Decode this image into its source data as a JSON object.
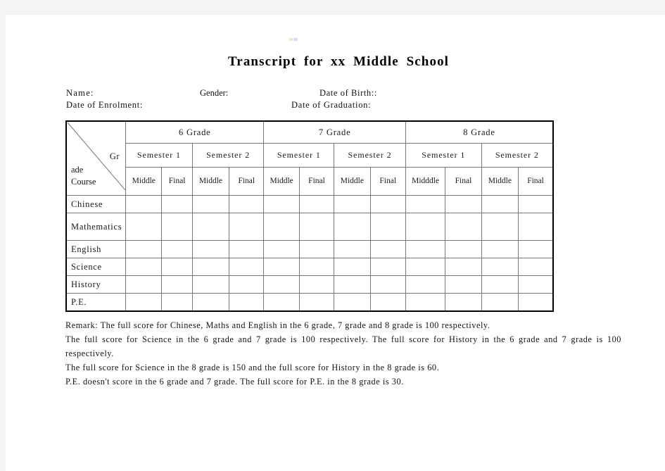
{
  "document": {
    "title": "Transcript for xx Middle School",
    "fields": {
      "name_label": "Name:",
      "gender_label": "Gender:",
      "date_of_birth_label": "Date of Birth::",
      "date_of_enrolment_label": "Date of Enrolment:",
      "date_of_graduation_label": "Date of Graduation:"
    }
  },
  "table": {
    "corner": {
      "grade_label": "Grade",
      "grade_part_upper": "Gr",
      "grade_part_lower": "ade",
      "course_label": "Course"
    },
    "grade_groups": [
      {
        "label": "6 Grade"
      },
      {
        "label": "7 Grade"
      },
      {
        "label": "8 Grade"
      }
    ],
    "semesters": [
      {
        "label": "Semester 1"
      },
      {
        "label": "Semester 2"
      },
      {
        "label": "Semester 1"
      },
      {
        "label": "Semester 2"
      },
      {
        "label": "Semester 1"
      },
      {
        "label": "Semester 2"
      }
    ],
    "exam_columns": [
      {
        "label": "Middle"
      },
      {
        "label": "Final"
      },
      {
        "label": "Middle"
      },
      {
        "label": "Final"
      },
      {
        "label": "Middle"
      },
      {
        "label": "Final"
      },
      {
        "label": "Middle"
      },
      {
        "label": "Final"
      },
      {
        "label": "Midddle"
      },
      {
        "label": "Final"
      },
      {
        "label": "Middle"
      },
      {
        "label": "Final"
      }
    ],
    "subjects": [
      {
        "label": "Chinese",
        "values": [
          "",
          "",
          "",
          "",
          "",
          "",
          "",
          "",
          "",
          "",
          "",
          ""
        ]
      },
      {
        "label": "Mathematics",
        "values": [
          "",
          "",
          "",
          "",
          "",
          "",
          "",
          "",
          "",
          "",
          "",
          ""
        ]
      },
      {
        "label": "English",
        "values": [
          "",
          "",
          "",
          "",
          "",
          "",
          "",
          "",
          "",
          "",
          "",
          ""
        ]
      },
      {
        "label": "Science",
        "values": [
          "",
          "",
          "",
          "",
          "",
          "",
          "",
          "",
          "",
          "",
          "",
          ""
        ]
      },
      {
        "label": "History",
        "values": [
          "",
          "",
          "",
          "",
          "",
          "",
          "",
          "",
          "",
          "",
          "",
          ""
        ]
      },
      {
        "label": "P.E.",
        "values": [
          "",
          "",
          "",
          "",
          "",
          "",
          "",
          "",
          "",
          "",
          "",
          ""
        ]
      }
    ]
  },
  "remark": {
    "line1": "Remark: The full score for Chinese, Maths and English in the 6 grade, 7 grade and 8 grade is 100 respectively.",
    "line2": "The full score for Science in the 6 grade and 7 grade is 100 respectively. The full score for History in the 6 grade and 7 grade is 100 respectively.",
    "line3": "The full score for Science in the 8 grade is 150 and the full score for History in the 8 grade is 60.",
    "line4": "P.E. doesn't score in the 6 grade and 7 grade. The full score for P.E. in the 8 grade is 30."
  }
}
